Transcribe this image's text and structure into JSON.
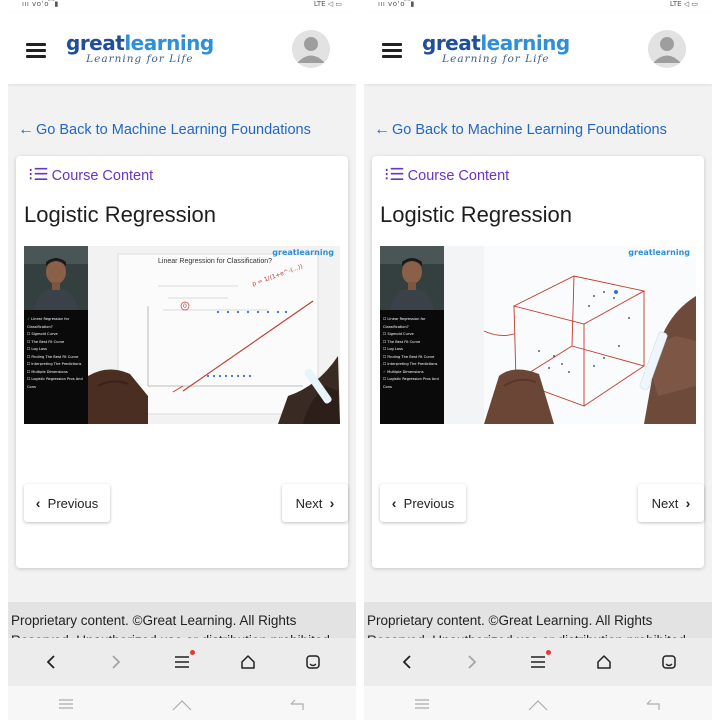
{
  "screens": [
    {
      "status": {
        "left": "ııı voʻo ͡ ▮",
        "right": "LTE ◁ ▭"
      },
      "logo": {
        "brand_a": "great",
        "brand_b": "learning",
        "tagline": "Learning for Life"
      },
      "back_link": "Go Back to Machine Learning Foundations",
      "course_content": "Course Content",
      "lesson_title": "Logistic Regression",
      "video": {
        "slide_title": "Linear Regression for Classification?",
        "brand": "greatlearning",
        "menu": [
          "Linear Regression for Classification?",
          "Sigmoid Curve",
          "The Best Fit Curve",
          "Log Loss",
          "Finding The Best Fit Curve",
          "Interpreting The Predictions",
          "Multiple Dimensions",
          "Logistic Regression Pros And Cons"
        ],
        "checked_index": 0
      },
      "prev_label": "Previous",
      "next_label": "Next",
      "footer_text": "Proprietary content. ©Great Learning. All Rights Reserved. Unauthorized use or distribution prohibited."
    },
    {
      "status": {
        "left": "ııı voʻo ͡ ▮",
        "right": "LTE ◁ ▭"
      },
      "logo": {
        "brand_a": "great",
        "brand_b": "learning",
        "tagline": "Learning for Life"
      },
      "back_link": "Go Back to Machine Learning Foundations",
      "course_content": "Course Content",
      "lesson_title": "Logistic Regression",
      "video": {
        "slide_title": "",
        "brand": "greatlearning",
        "menu": [
          "Linear Regression for Classification?",
          "Sigmoid Curve",
          "The Best Fit Curve",
          "Log Loss",
          "Finding The Best Fit Curve",
          "Interpreting The Predictions",
          "Multiple Dimensions",
          "Logistic Regression Pros And Cons"
        ],
        "checked_index": 6
      },
      "prev_label": "Previous",
      "next_label": "Next",
      "footer_text": "Proprietary content. ©Great Learning. All Rights Reserved. Unauthorized use or distribution prohibited."
    }
  ]
}
